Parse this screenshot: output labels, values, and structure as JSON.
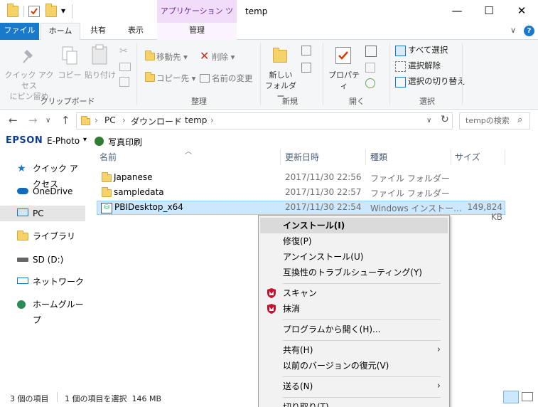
{
  "window": {
    "title": "temp",
    "context_tab_header": "アプリケーション ツール",
    "minimize": "—",
    "maximize": "☐",
    "close": "✕",
    "qat_dropdown": "▾"
  },
  "ribbon_tabs": {
    "file": "ファイル",
    "home": "ホーム",
    "share": "共有",
    "view": "表示",
    "manage": "管理",
    "collapse": "∨",
    "help": "?"
  },
  "ribbon": {
    "clipboard": {
      "pin_label": "クイック アクセス\nにピン留め",
      "copy_label": "コピー",
      "paste_label": "貼り付け",
      "group_label": "クリップボード"
    },
    "organize": {
      "move_to": "移動先 ▾",
      "copy_to": "コピー先 ▾",
      "delete": "削除 ▾",
      "rename": "名前の変更",
      "group_label": "整理"
    },
    "new": {
      "new_folder": "新しい\nフォルダー",
      "group_label": "新規"
    },
    "open": {
      "properties": "プロパティ",
      "group_label": "開く"
    },
    "select": {
      "select_all": "すべて選択",
      "select_none": "選択解除",
      "invert": "選択の切り替え",
      "group_label": "選択"
    }
  },
  "address": {
    "back": "←",
    "forward": "→",
    "up": "↑",
    "crumbs": [
      "PC",
      "ダウンロード",
      "temp"
    ],
    "refresh": "↻",
    "search_placeholder": "tempの検索"
  },
  "epson": {
    "brand": "EPSON",
    "app": "E-Photo",
    "print": "写真印刷"
  },
  "nav": [
    {
      "label": "クイック アクセス"
    },
    {
      "label": "OneDrive"
    },
    {
      "label": "PC"
    },
    {
      "label": "ライブラリ"
    },
    {
      "label": "SD (D:)"
    },
    {
      "label": "ネットワーク"
    },
    {
      "label": "ホームグループ"
    }
  ],
  "columns": {
    "name": "名前",
    "date": "更新日時",
    "type": "種類",
    "size": "サイズ"
  },
  "files": [
    {
      "name": "Japanese",
      "date": "2017/11/30 22:56",
      "type": "ファイル フォルダー",
      "size": ""
    },
    {
      "name": "sampledata",
      "date": "2017/11/30 22:57",
      "type": "ファイル フォルダー",
      "size": ""
    },
    {
      "name": "PBIDesktop_x64",
      "date": "2017/11/30 22:54",
      "type": "Windows インストー...",
      "size": "149,824 KB"
    }
  ],
  "status": {
    "count": "3 個の項目",
    "selected": "1 個の項目を選択  146 MB"
  },
  "context_menu": {
    "install": "インストール(I)",
    "repair": "修復(P)",
    "uninstall": "アンインストール(U)",
    "troubleshoot": "互換性のトラブルシューティング(Y)",
    "scan": "スキャン",
    "shred": "抹消",
    "open_with": "プログラムから開く(H)...",
    "share": "共有(H)",
    "restore": "以前のバージョンの復元(V)",
    "send_to": "送る(N)",
    "cut": "切り取り(T)",
    "arrow": "›"
  },
  "colors": {
    "file_tab": "#1979ca",
    "context_tab": "#f1dcfa",
    "selection": "#cce8ff",
    "mcafee_red": "#c8102e"
  }
}
